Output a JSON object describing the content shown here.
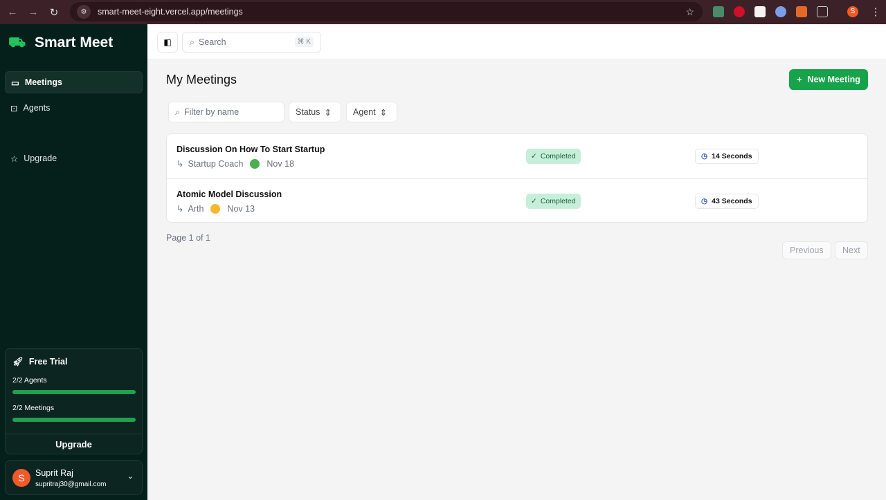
{
  "browser": {
    "url": "smart-meet-eight.vercel.app/meetings",
    "profile_initial": "S"
  },
  "app": {
    "name": "Smart Meet"
  },
  "sidebar": {
    "items": [
      {
        "label": "Meetings",
        "icon": "video-icon",
        "active": true
      },
      {
        "label": "Agents",
        "icon": "bot-icon"
      },
      {
        "label": "Upgrade",
        "icon": "star-icon"
      }
    ]
  },
  "trial": {
    "title": "Free Trial",
    "agents_label": "2/2 Agents",
    "agents_progress": 1.0,
    "meetings_label": "2/2 Meetings",
    "meetings_progress": 1.0,
    "upgrade": "Upgrade"
  },
  "user": {
    "initial": "S",
    "name": "Suprit Raj",
    "email": "supritraj30@gmail.com"
  },
  "topbar": {
    "search_placeholder": "Search",
    "shortcut": "⌘ K"
  },
  "main": {
    "title": "My Meetings",
    "new_meeting": "New Meeting",
    "filters": {
      "name_placeholder": "Filter by name",
      "status": "Status",
      "agent": "Agent"
    },
    "meetings": [
      {
        "name": "Discussion On How To Start Startup",
        "agent": "Startup Coach",
        "date": "Nov 18",
        "status": "Completed",
        "duration": "14 Seconds",
        "avatar_color": "#4caf50"
      },
      {
        "name": "Atomic Model Discussion",
        "agent": "Arth",
        "date": "Nov 13",
        "status": "Completed",
        "duration": "43 Seconds",
        "avatar_color": "#f5b82e"
      }
    ],
    "pagination": {
      "label": "Page 1 of 1",
      "previous": "Previous",
      "next": "Next"
    }
  },
  "colors": {
    "accent": "#16a34a",
    "sidebar": "#05201a",
    "badge": "#c7eedb"
  }
}
